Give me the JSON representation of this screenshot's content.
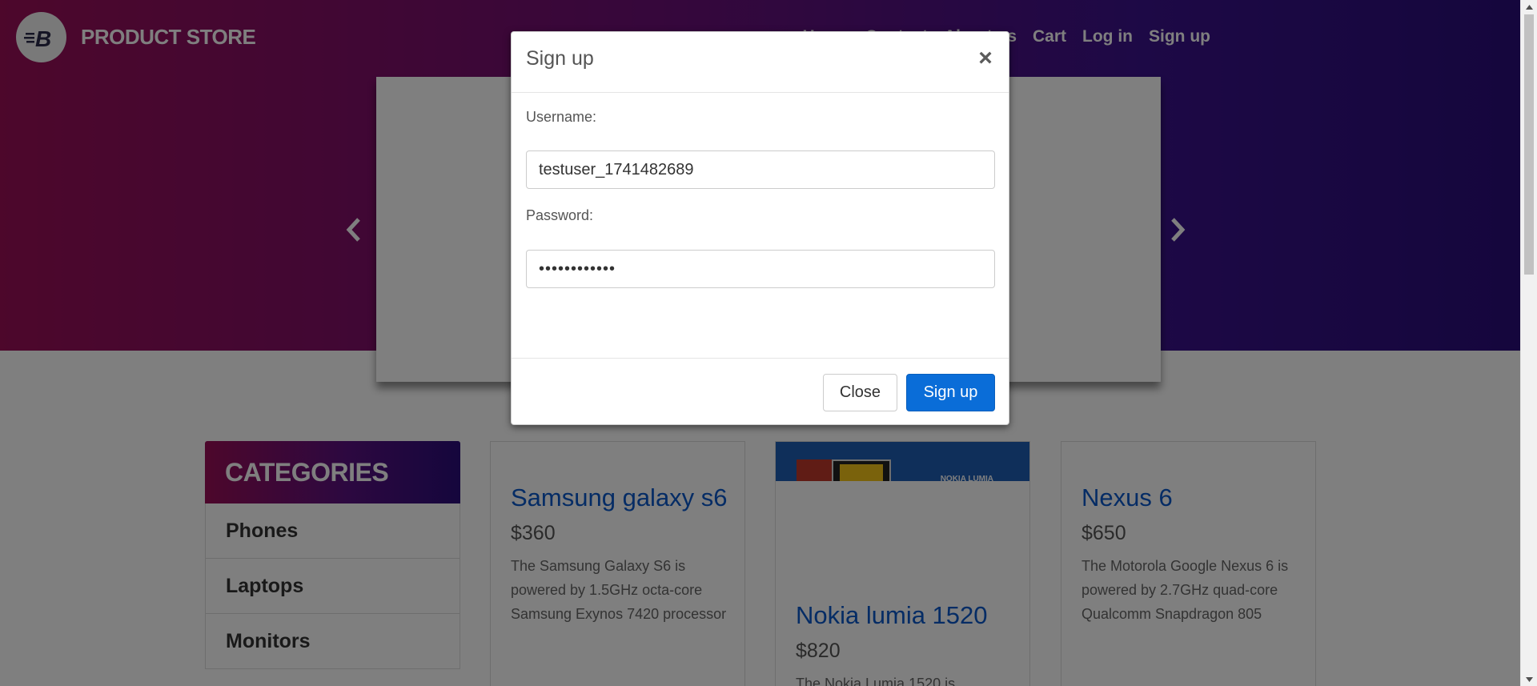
{
  "header": {
    "brand": "PRODUCT STORE",
    "nav": [
      "Home",
      "Contact",
      "About us",
      "Cart",
      "Log in",
      "Sign up"
    ]
  },
  "categories": {
    "title": "CATEGORIES",
    "items": [
      "Phones",
      "Laptops",
      "Monitors"
    ]
  },
  "products": [
    {
      "title": "Samsung galaxy s6",
      "price": "$360",
      "desc": "The Samsung Galaxy S6 is powered by 1.5GHz octa-core Samsung Exynos 7420 processor"
    },
    {
      "title": "Nokia lumia 1520",
      "price": "$820",
      "desc": "The Nokia Lumia 1520 is",
      "image_text": "NOKIA LUMIA"
    },
    {
      "title": "Nexus 6",
      "price": "$650",
      "desc": "The Motorola Google Nexus 6 is powered by 2.7GHz quad-core Qualcomm Snapdragon 805"
    }
  ],
  "modal": {
    "title": "Sign up",
    "close_glyph": "×",
    "username_label": "Username:",
    "username_value": "testuser_1741482689",
    "password_label": "Password:",
    "password_value": "••••••••••••",
    "close_button": "Close",
    "signup_button": "Sign up"
  },
  "colors": {
    "accent": "#0a6dd8",
    "link": "#0a58ca",
    "gradient_start": "#9a0e57",
    "gradient_end": "#2a0d7a"
  }
}
